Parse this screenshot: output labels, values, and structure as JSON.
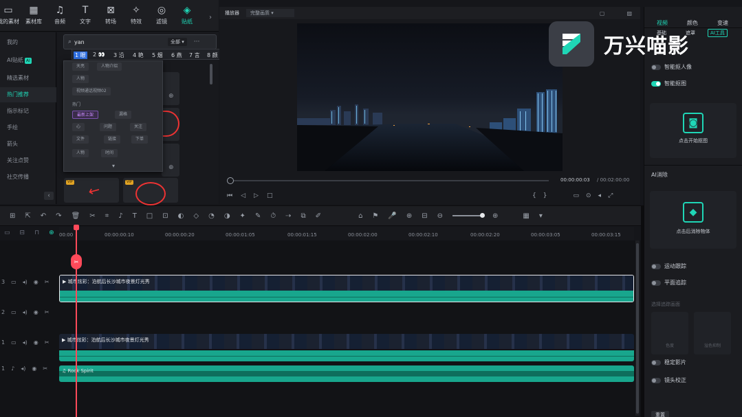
{
  "toolbar": {
    "items": [
      {
        "label": "我的素材",
        "icon": "folder-icon"
      },
      {
        "label": "素材库",
        "icon": "library-icon"
      },
      {
        "label": "音频",
        "icon": "music-icon"
      },
      {
        "label": "文字",
        "icon": "text-icon"
      },
      {
        "label": "转场",
        "icon": "transition-icon"
      },
      {
        "label": "特效",
        "icon": "effects-icon"
      },
      {
        "label": "滤镜",
        "icon": "filter-icon"
      },
      {
        "label": "贴纸",
        "icon": "sticker-icon"
      }
    ]
  },
  "leftnav": {
    "items": [
      {
        "label": "我的"
      },
      {
        "label": "AI贴纸",
        "badge": "AI"
      },
      {
        "label": "精选素材"
      },
      {
        "label": "热门推荐"
      },
      {
        "label": "指示标记"
      },
      {
        "label": "手绘"
      },
      {
        "label": "箭头"
      },
      {
        "label": "关注点赞"
      },
      {
        "label": "社交传播"
      }
    ]
  },
  "search": {
    "value": "yan",
    "filter": "全部"
  },
  "ime": {
    "candidates": [
      "1 眼",
      "2 👀",
      "3 沿",
      "4 艳",
      "5 烟",
      "6 燕",
      "7 言",
      "8 颜"
    ]
  },
  "suggest": {
    "tags_row1": [
      "天亮",
      "人物介绍"
    ],
    "tags_row2": [
      "人物"
    ],
    "tags_row3": [
      "视频通话视频02"
    ],
    "section": "热门",
    "tags_row4": [
      "最新上架",
      "漏格"
    ],
    "tags_row5": [
      "心",
      "问题",
      "关注"
    ],
    "tags_row6": [
      "文件",
      "链接",
      "下单"
    ],
    "tags_row7": [
      "人物",
      "时间"
    ]
  },
  "grid": {
    "vip_label": "VIP"
  },
  "player": {
    "label": "播放器",
    "quality": "完整画质",
    "time_current": "00:00:00:03",
    "time_total": "/ 00:02:00:00"
  },
  "rightpanel": {
    "tabs": [
      "视频",
      "颜色",
      "变速"
    ],
    "subtabs": [
      "基础",
      "遮罩",
      "AI工具"
    ],
    "smart_portrait": "智能抠人像",
    "smart_cutout": "智能抠图",
    "start_cutout": "点击开始抠图",
    "ai_remove_title": "AI消除",
    "ai_remove_btn": "点击后消除物体",
    "motion_track": "运动跟踪",
    "plane_track": "平面追踪",
    "selected_area": "选择追踪画面",
    "chromakey": "色度",
    "spill": "溢色抑制",
    "stabilize": "稳定影片",
    "lens_correct": "镜头校正",
    "reset": "重置"
  },
  "timeline": {
    "ruler": [
      "00:00",
      "00:00:00:10",
      "00:00:00:20",
      "00:00:01:05",
      "00:00:01:15",
      "00:00:02:00",
      "00:00:02:10",
      "00:00:02:20",
      "00:00:03:05",
      "00:00:03:15"
    ],
    "track_numbers": [
      "3",
      "2",
      "1",
      "1"
    ],
    "clip_top_title": "城市炫彩：泊航后长沙城市夜景灯光秀",
    "clip_mid_title": "城市炫彩：泊航后长沙城市夜景灯光秀",
    "audio_title": "Rock Spirit"
  },
  "logo": {
    "text": "万兴喵影"
  }
}
